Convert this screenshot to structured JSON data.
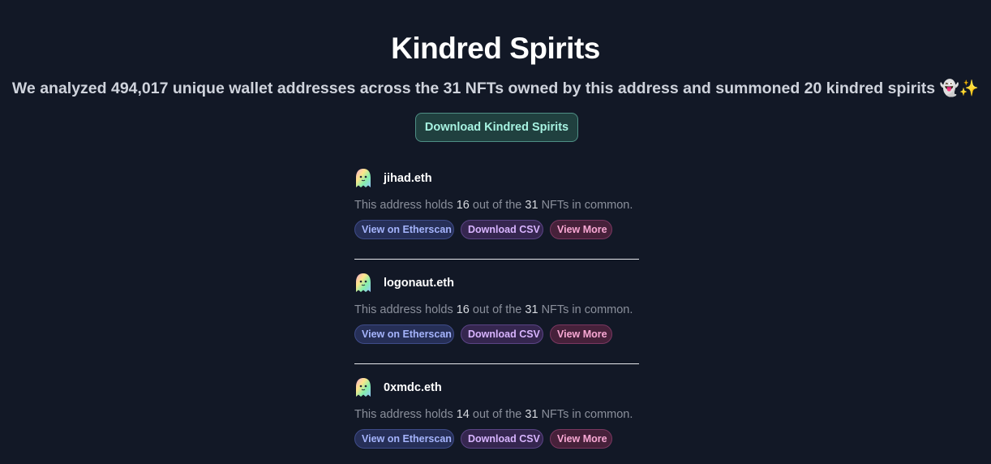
{
  "header": {
    "title": "Kindred Spirits",
    "subtitle": "We analyzed 494,017 unique wallet addresses across the 31 NFTs owned by this address and summoned 20 kindred spirits 👻✨",
    "download_label": "Download Kindred Spirits"
  },
  "colors": {
    "background": "#121826",
    "accent_teal": "#a7f3e2",
    "etherscan_pill": "#a5b4fc",
    "csv_pill": "#d8b4fe",
    "more_pill": "#f9a8d4"
  },
  "spirits": [
    {
      "name": "jihad.eth",
      "icon": "ghost-icon",
      "desc_prefix": "This address holds",
      "held": "16",
      "desc_middle": "out of the",
      "total": "31",
      "desc_suffix": "NFTs in common.",
      "etherscan_label": "View on Etherscan",
      "csv_label": "Download CSV",
      "more_label": "View More"
    },
    {
      "name": "logonaut.eth",
      "icon": "ghost-icon",
      "desc_prefix": "This address holds",
      "held": "16",
      "desc_middle": "out of the",
      "total": "31",
      "desc_suffix": "NFTs in common.",
      "etherscan_label": "View on Etherscan",
      "csv_label": "Download CSV",
      "more_label": "View More"
    },
    {
      "name": "0xmdc.eth",
      "icon": "ghost-icon",
      "desc_prefix": "This address holds",
      "held": "14",
      "desc_middle": "out of the",
      "total": "31",
      "desc_suffix": "NFTs in common.",
      "etherscan_label": "View on Etherscan",
      "csv_label": "Download CSV",
      "more_label": "View More"
    }
  ]
}
